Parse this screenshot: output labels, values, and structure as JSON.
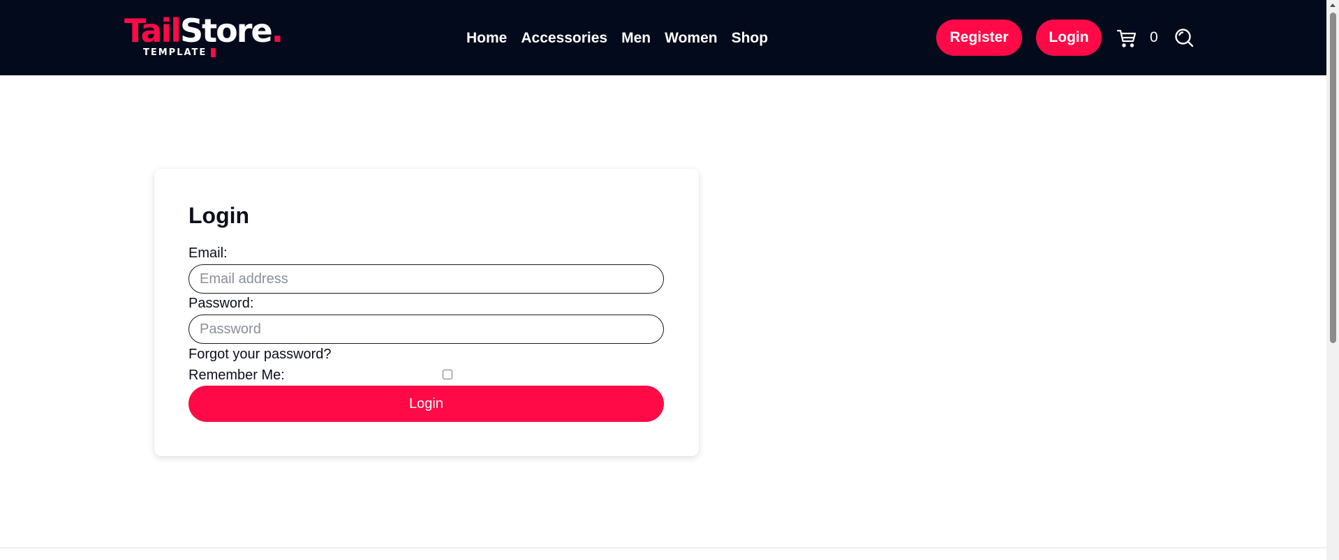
{
  "brand": {
    "logo_part1": "Tail",
    "logo_part2": "Store",
    "logo_dot": ".",
    "logo_sub": "TEMPLATE"
  },
  "nav": {
    "items": [
      {
        "label": "Home"
      },
      {
        "label": "Accessories"
      },
      {
        "label": "Men"
      },
      {
        "label": "Women"
      },
      {
        "label": "Shop"
      }
    ]
  },
  "header_actions": {
    "register_label": "Register",
    "login_label": "Login",
    "cart_count": "0",
    "cart_icon": "cart-icon",
    "search_icon": "search-icon"
  },
  "login_form": {
    "title": "Login",
    "email_label": "Email:",
    "email_placeholder": "Email address",
    "email_value": "",
    "password_label": "Password:",
    "password_placeholder": "Password",
    "password_value": "",
    "forgot_label": "Forgot your password?",
    "remember_label": "Remember Me:",
    "remember_checked": false,
    "submit_label": "Login"
  },
  "colors": {
    "header_bg": "#030a1b",
    "accent": "#ff0a47",
    "page_bg": "#ffffff"
  }
}
